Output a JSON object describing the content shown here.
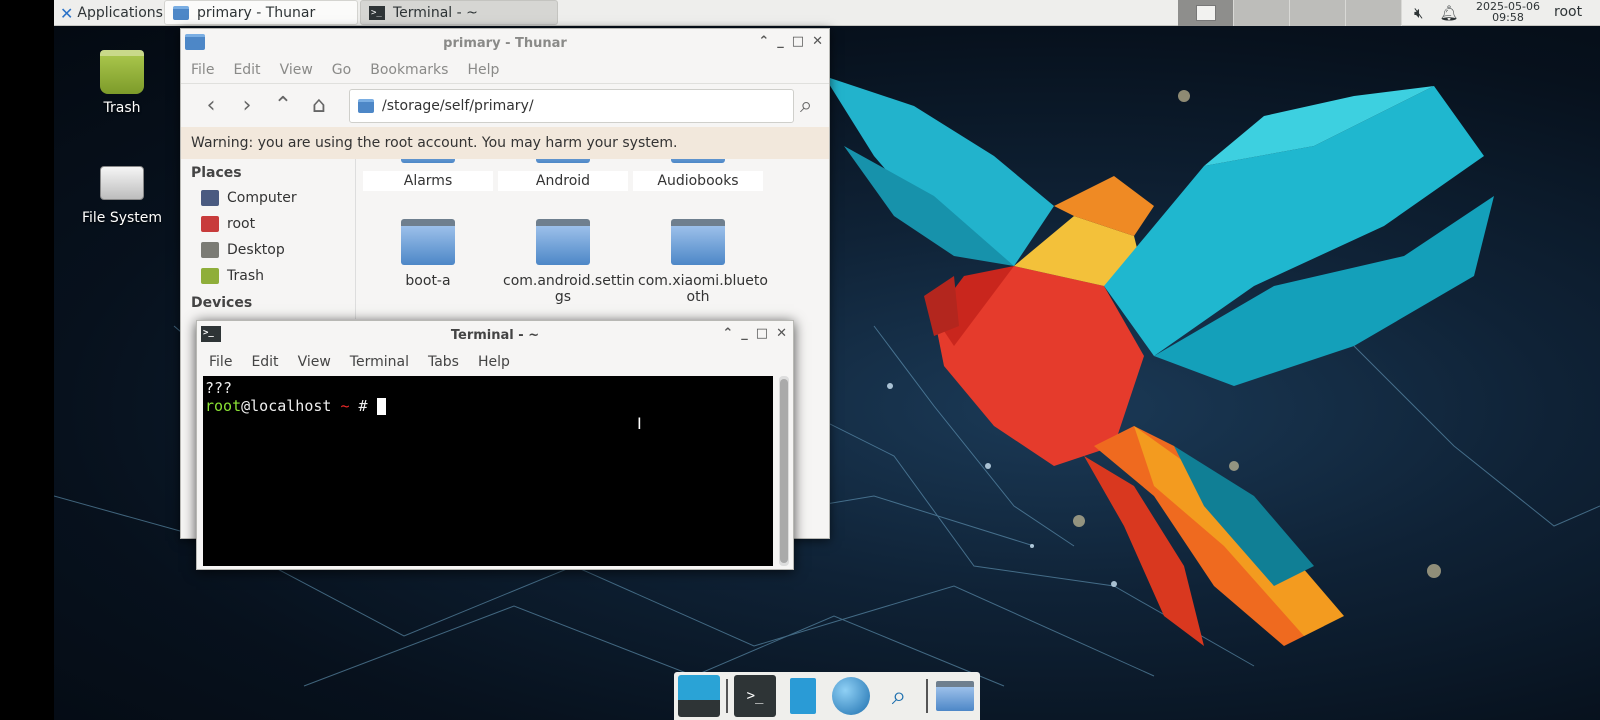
{
  "panel": {
    "applications": "Applications",
    "tasks": [
      {
        "label": "primary - Thunar"
      },
      {
        "label": "Terminal - ~"
      }
    ],
    "date": "2025-05-06",
    "time": "09:58",
    "user": "root"
  },
  "desktop_icons": [
    {
      "label": "Trash"
    },
    {
      "label": "File System"
    }
  ],
  "thunar": {
    "title": "primary - Thunar",
    "menu": [
      "File",
      "Edit",
      "View",
      "Go",
      "Bookmarks",
      "Help"
    ],
    "location": "/storage/self/primary/",
    "warning": "Warning: you are using the root account. You may harm your system.",
    "places_header": "Places",
    "places": [
      "Computer",
      "root",
      "Desktop",
      "Trash"
    ],
    "devices_header": "Devices",
    "files": [
      "Alarms",
      "Android",
      "Audiobooks",
      "boot-a",
      "com.android.settin gs",
      "com.xiaomi.blueto oth"
    ]
  },
  "terminal": {
    "title": "Terminal - ~",
    "menu": [
      "File",
      "Edit",
      "View",
      "Terminal",
      "Tabs",
      "Help"
    ],
    "garbled": "???",
    "prompt_user": "root",
    "prompt_host": "@localhost",
    "prompt_path": "~",
    "prompt_symbol": "#"
  },
  "colors": {
    "accent": "#4d87c7",
    "warning_bg": "#f2e8dc",
    "prompt_user": "#8ae234",
    "prompt_path": "#ef2929"
  }
}
